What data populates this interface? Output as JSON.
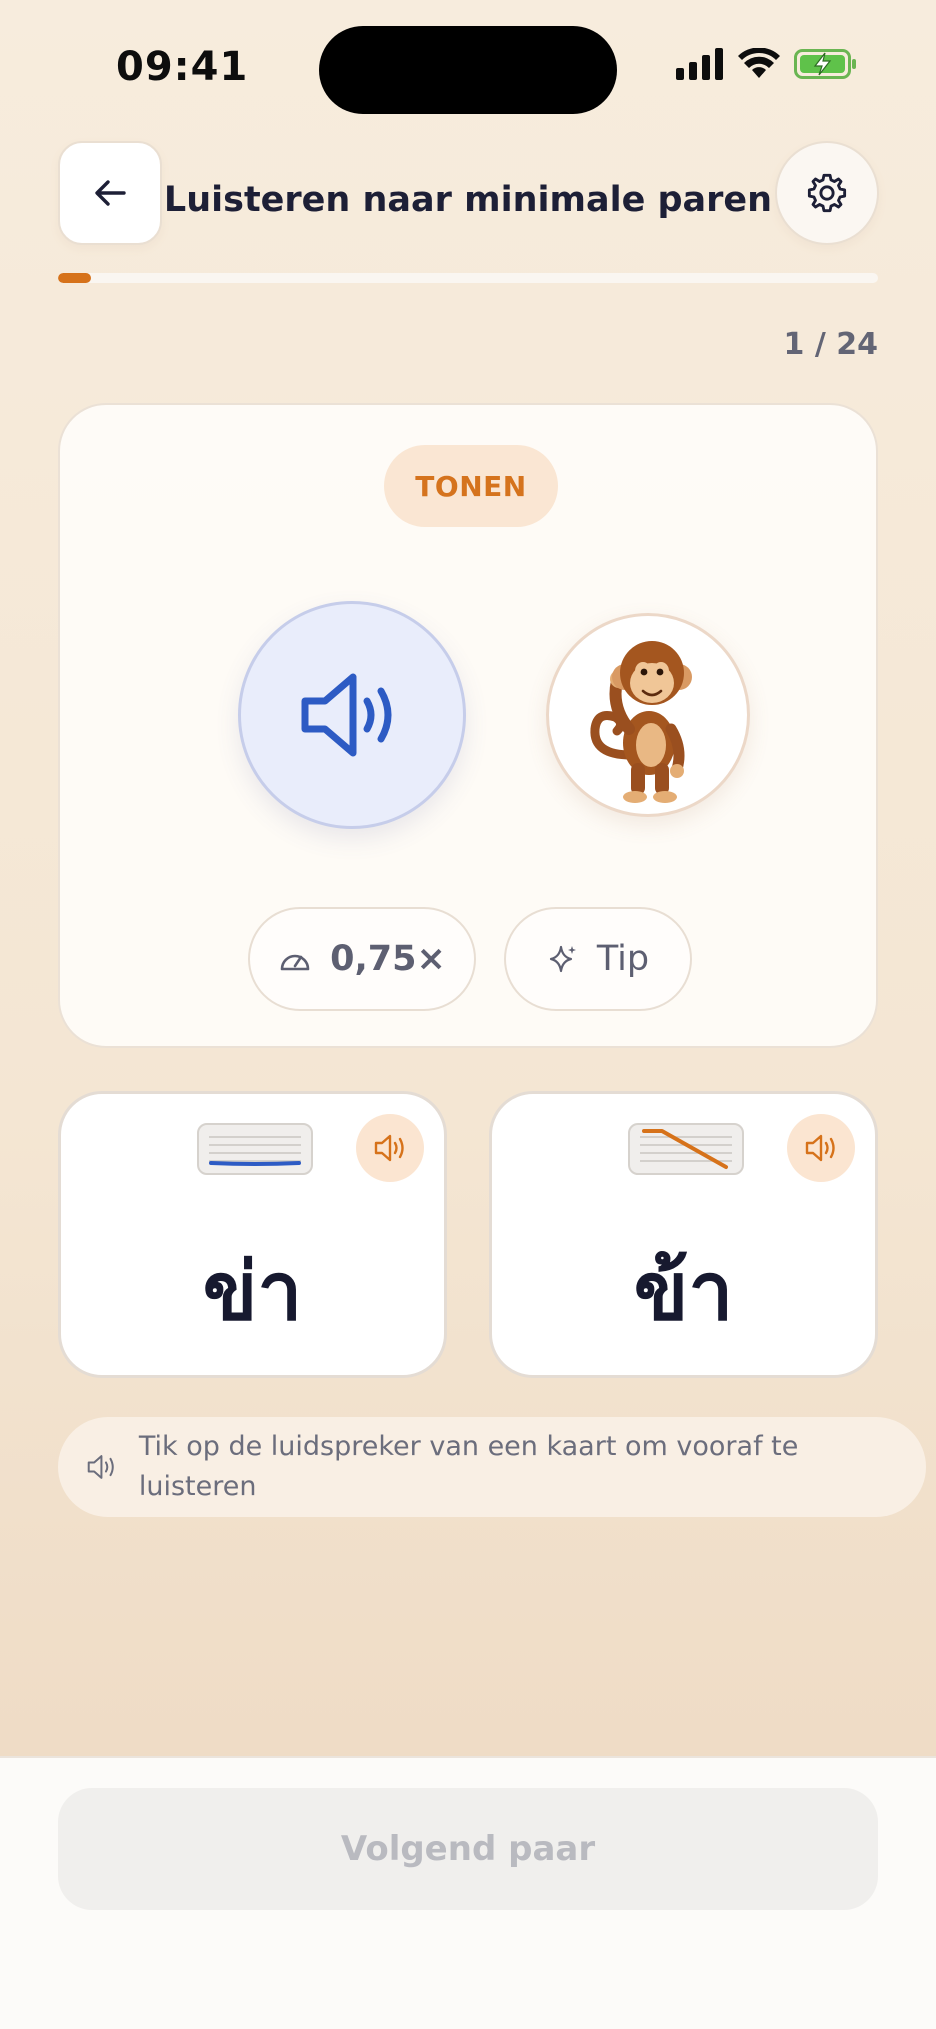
{
  "status_bar": {
    "time": "09:41"
  },
  "header": {
    "title": "Luisteren naar minimale paren"
  },
  "progress": {
    "fraction": 0.04,
    "counter": "1 / 24"
  },
  "main_card": {
    "badge": "TONEN",
    "speed_label": "0,75×",
    "tip_label": "Tip"
  },
  "options": [
    {
      "word": "ข่า",
      "tone_contour": "low-flat",
      "tone_color": "#2d5bc4"
    },
    {
      "word": "ข้า",
      "tone_contour": "falling",
      "tone_color": "#d6721a"
    }
  ],
  "hint": {
    "text": "Tik op de luidspreker van een kaart om vooraf te luisteren"
  },
  "footer": {
    "next_label": "Volgend paar"
  },
  "colors": {
    "accent": "#d6721a",
    "play_blue": "#2d5bc4",
    "badge_bg": "#fae6d3"
  }
}
